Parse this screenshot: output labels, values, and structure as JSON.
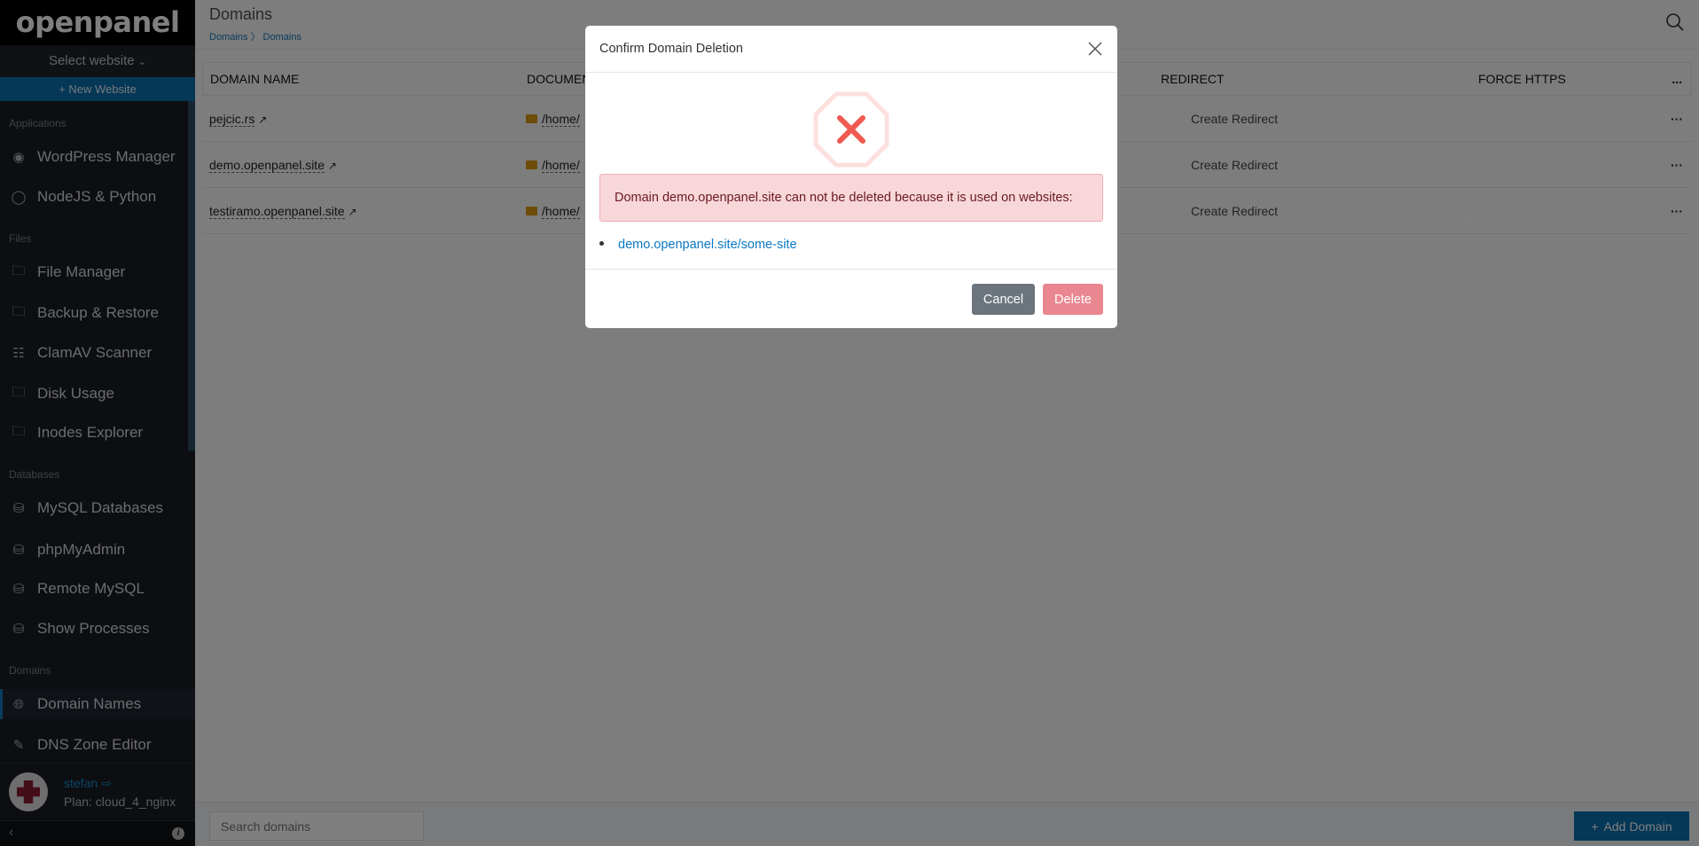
{
  "sidebar": {
    "logo": "openpanel",
    "select_website": "Select website",
    "new_website": "+ New Website",
    "sections": [
      {
        "label": "Applications",
        "items": [
          {
            "label": "WordPress Manager",
            "icon": "wordpress-icon"
          },
          {
            "label": "NodeJS & Python",
            "icon": "nodejs-icon"
          }
        ]
      },
      {
        "label": "Files",
        "items": [
          {
            "label": "File Manager",
            "icon": "folder-icon"
          },
          {
            "label": "Backup & Restore",
            "icon": "folder-check-icon"
          },
          {
            "label": "ClamAV Scanner",
            "icon": "barcode-scan-icon"
          },
          {
            "label": "Disk Usage",
            "icon": "folder-plus-icon"
          },
          {
            "label": "Inodes Explorer",
            "icon": "folder-x-icon"
          }
        ]
      },
      {
        "label": "Databases",
        "items": [
          {
            "label": "MySQL Databases",
            "icon": "database-icon"
          },
          {
            "label": "phpMyAdmin",
            "icon": "database-gear-icon"
          },
          {
            "label": "Remote MySQL",
            "icon": "database-info-icon"
          },
          {
            "label": "Show Processes",
            "icon": "database-check-icon"
          }
        ]
      },
      {
        "label": "Domains",
        "items": [
          {
            "label": "Domain Names",
            "icon": "globe-icon",
            "active": true
          },
          {
            "label": "DNS Zone Editor",
            "icon": "edit-icon"
          }
        ]
      }
    ],
    "user": {
      "name": "stefan",
      "plan": "Plan: cloud_4_nginx"
    }
  },
  "header": {
    "title": "Domains",
    "breadcrumb": [
      "Domains",
      "Domains"
    ]
  },
  "table": {
    "columns": [
      "DOMAIN NAME",
      "DOCUMENT",
      "REDIRECT",
      "FORCE HTTPS",
      "..."
    ],
    "rows": [
      {
        "domain": "pejcic.rs",
        "docroot": "/home/",
        "redirect": "Create Redirect",
        "force_https": false
      },
      {
        "domain": "demo.openpanel.site",
        "docroot": "/home/",
        "redirect": "Create Redirect",
        "force_https": false
      },
      {
        "domain": "testiramo.openpanel.site",
        "docroot": "/home/",
        "redirect": "Create Redirect",
        "force_https": true
      }
    ]
  },
  "footer": {
    "search_placeholder": "Search domains",
    "add_domain": "Add Domain"
  },
  "modal": {
    "title": "Confirm Domain Deletion",
    "message": "Domain demo.openpanel.site can not be deleted because it is used on websites:",
    "websites": [
      "demo.openpanel.site/some-site"
    ],
    "cancel": "Cancel",
    "delete": "Delete"
  },
  "colors": {
    "accent": "#0a6fad",
    "danger": "#ea868f",
    "alert_bg": "#f8d7da",
    "error_icon": "#f05a50"
  }
}
